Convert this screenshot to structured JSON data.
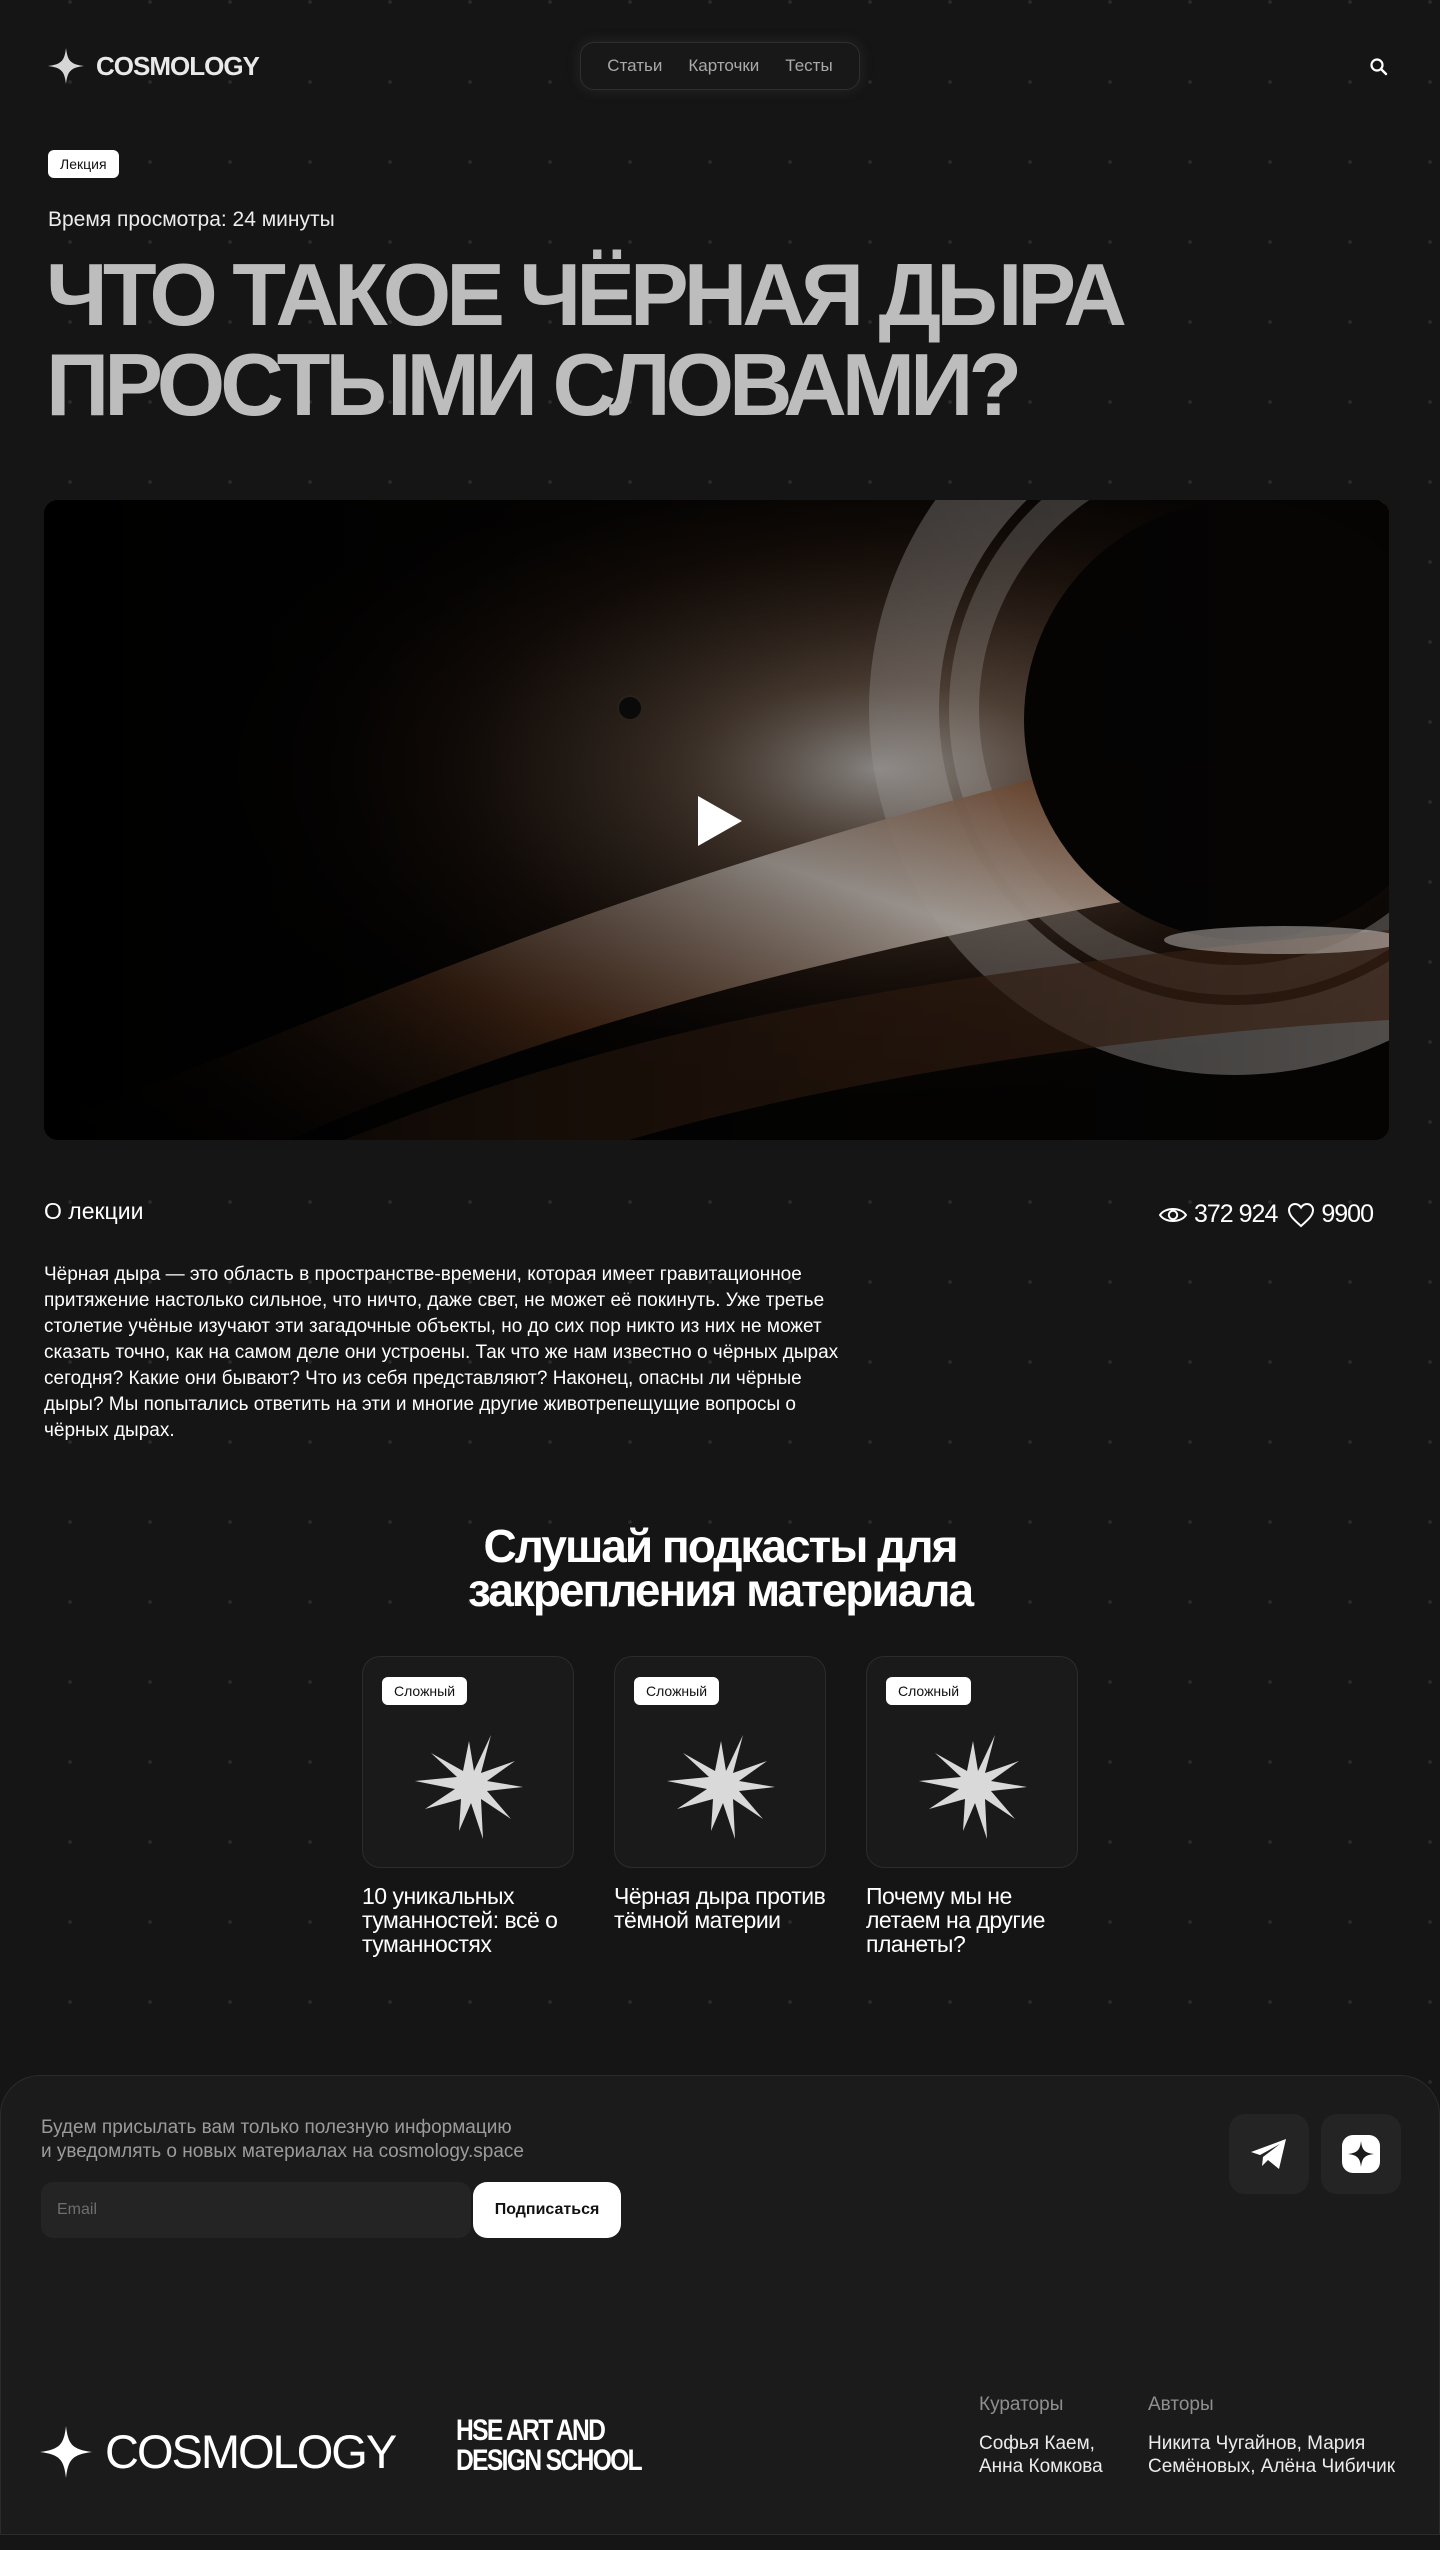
{
  "header": {
    "logo_text": "COSMOLOGY",
    "nav": [
      "Статьи",
      "Карточки",
      "Тесты"
    ],
    "search_icon": "search-icon"
  },
  "hero": {
    "tag": "Лекция",
    "watch_time": "Время просмотра: 24 минуты",
    "title_line1": "Что такое чёрная дыра",
    "title_line2": "простыми словами?"
  },
  "video": {
    "play_icon": "play-icon"
  },
  "about": {
    "title": "О лекции",
    "views": "372 924",
    "likes": "9900",
    "paragraph": "Чёрная дыра — это область в пространстве-времени, которая имеет гравитационное притяжение настолько сильное, что ничто, даже свет, не может её покинуть. Уже третье столетие учёные изучают эти загадочные объекты, но до сих пор никто из них не может сказать точно, как на самом деле они устроены. Так что же нам известно о чёрных дырах сегодня? Какие они бывают? Что из себя представляют? Наконец, опасны ли чёрные дыры? Мы попытались ответить на эти и многие другие животрепещущие вопросы о чёрных дырах."
  },
  "podcasts": {
    "heading_line1": "Слушай подкасты для",
    "heading_line2": "закрепления материала",
    "cards": [
      {
        "badge": "Сложный",
        "title": "10 уникальных туманностей: всё о туманностях"
      },
      {
        "badge": "Сложный",
        "title": "Чёрная дыра против тёмной материи"
      },
      {
        "badge": "Сложный",
        "title": "Почему мы не летаем на другие планеты?"
      }
    ]
  },
  "footer": {
    "subscribe_text_line1": "Будем присылать вам только полезную информацию",
    "subscribe_text_line2": "и уведомлять о новых материалах на cosmology.space",
    "email_placeholder": "Email",
    "subscribe_label": "Подписаться",
    "logo_text": "COSMOLOGY",
    "school_line1": "HSE ART AND",
    "school_line2": "DESIGN SCHOOL",
    "curators_label": "Кураторы",
    "curators_line1": "Софья Каем,",
    "curators_line2": "Анна Комкова",
    "authors_label": "Авторы",
    "authors_line1": "Никита Чугайнов, Мария",
    "authors_line2": "Семёновых, Алёна Чибичик"
  },
  "colors": {
    "background": "#151515",
    "title_gray": "#bdbdbd",
    "badge_bg": "#ffffff",
    "footer_bg": "#1b1b1b"
  }
}
